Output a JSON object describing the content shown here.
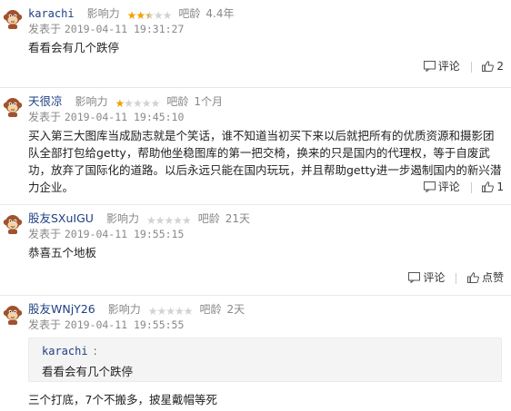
{
  "icons": {
    "comment": "comment-icon",
    "like": "thumbs-up-icon",
    "avatar": "monkey-avatar-icon",
    "star": "star-icon"
  },
  "colors": {
    "username": "#1e3f82",
    "star_on": "#f0a200",
    "star_off": "#d2d2d2",
    "muted": "#888888"
  },
  "labels": {
    "influence": "影响力",
    "forum_age": "吧龄",
    "posted_at": "发表于",
    "comment": "评论",
    "like": "点赞"
  },
  "comments": [
    {
      "username": "karachi",
      "rating": 2.5,
      "forum_age": "4.4年",
      "time": "2019-04-11 19:31:27",
      "content": "看看会有几个跌停",
      "like_count": "2"
    },
    {
      "username": "天很凉",
      "rating": 1,
      "forum_age": "1个月",
      "time": "2019-04-11 19:45:10",
      "content": "买入第三大图库当成励志就是个笑话，谁不知道当初买下来以后就把所有的优质资源和摄影团队全部打包给getty，帮助他坐稳图库的第一把交椅，换来的只是国内的代理权，等于自废武功，放弃了国际化的道路。以后永远只能在国内玩玩，并且帮助getty进一步遏制国内的新兴潜力企业。",
      "like_count": "1"
    },
    {
      "username": "股友SXuIGU",
      "rating": 0,
      "forum_age": "21天",
      "time": "2019-04-11 19:55:15",
      "content": "恭喜五个地板"
    },
    {
      "username": "股友WNjY26",
      "rating": 0,
      "forum_age": "2天",
      "time": "2019-04-11 19:55:55",
      "quote": {
        "username": "karachi",
        "colon": ":",
        "content": "看看会有几个跌停"
      },
      "content": "三个打底，7个不搬多，披星戴帽等死"
    }
  ]
}
